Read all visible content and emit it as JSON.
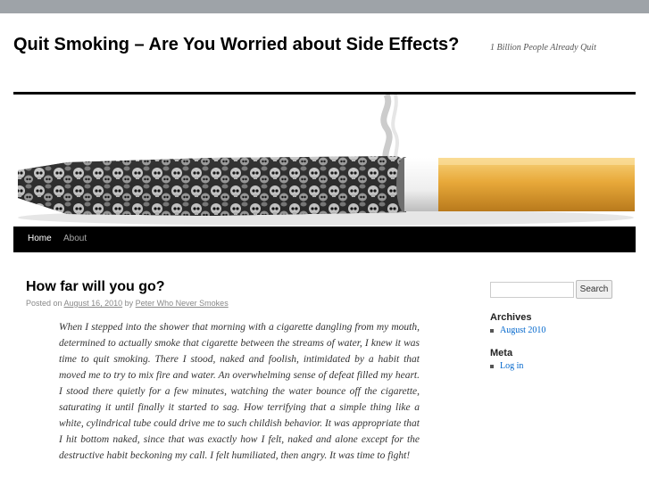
{
  "site": {
    "title": "Quit Smoking – Are You Worried about Side Effects?",
    "description": "1 Billion People Already Quit"
  },
  "nav": {
    "items": [
      {
        "label": "Home",
        "current": true
      },
      {
        "label": "About",
        "current": false
      }
    ]
  },
  "post": {
    "title": "How far will you go?",
    "meta_prefix": "Posted on",
    "date": "August 16, 2010",
    "by": "by",
    "author": "Peter Who Never Smokes",
    "body": "When I stepped into the shower that morning with a cigarette dangling from my mouth, determined to actually smoke that cigarette between the streams of water, I knew it was time to quit smoking. There I stood, naked and foolish, intimidated by a habit that moved me to try to mix fire and water. An overwhelming sense of defeat filled my heart. I stood there quietly for a few minutes, watching the water bounce off the cigarette, saturating it until finally it started to sag. How terrifying that a simple thing like a white, cylindrical tube could drive me to such childish behavior. It was appropriate that I hit bottom naked, since that was exactly how I felt, naked and alone except for the destructive habit beckoning my call. I felt humiliated, then angry. It was time to fight!"
  },
  "sidebar": {
    "search": {
      "placeholder": "",
      "button_label": "Search"
    },
    "archives": {
      "title": "Archives",
      "items": [
        "August 2010"
      ]
    },
    "meta": {
      "title": "Meta",
      "items": [
        "Log in"
      ]
    }
  },
  "colors": {
    "topbar": "#9ea3a8",
    "nav_bg": "#000000",
    "link": "#0066cc",
    "cigarette_filter": "#e8a93a"
  },
  "header_image": {
    "icon": "cigarette-of-skulls-image"
  }
}
